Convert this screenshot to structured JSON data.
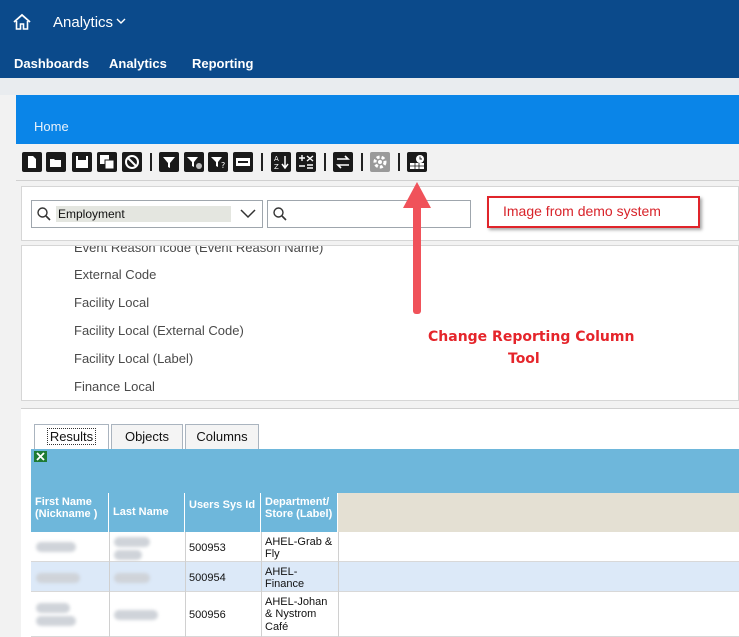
{
  "shell": {
    "app_title": "Analytics",
    "nav": [
      "Dashboards",
      "Analytics",
      "Reporting"
    ]
  },
  "page": {
    "home_label": "Home"
  },
  "search": {
    "combo_value": "Employment",
    "search_value": ""
  },
  "callout": {
    "text": "Image from demo system"
  },
  "fields": [
    "Event Reason Icode (Event Reason Name)",
    "External Code",
    "Facility Local",
    "Facility Local (External Code)",
    "Facility Local (Label)",
    "Finance Local"
  ],
  "annotation": {
    "line1": "Change Reporting Column",
    "line2": "Tool"
  },
  "tabs": [
    "Results",
    "Objects",
    "Columns"
  ],
  "table": {
    "headers": [
      "First Name (Nickname )",
      "Last Name",
      "Users Sys Id",
      "Department/Store (Label)"
    ],
    "rows": [
      {
        "users_sys_id": "500953",
        "department_line1": "AHEL-Grab &",
        "department_line2": "Fly",
        "department_line3": ""
      },
      {
        "users_sys_id": "500954",
        "department_line1": "AHEL-",
        "department_line2": "Finance",
        "department_line3": ""
      },
      {
        "users_sys_id": "500956",
        "department_line1": "AHEL-Johan",
        "department_line2": "& Nystrom",
        "department_line3": "Café"
      }
    ]
  },
  "colors": {
    "shell": "#0b4a8b",
    "band": "#0a85e8",
    "accent_red": "#e5252b",
    "table_header": "#6eb7db"
  },
  "icons": [
    "home-icon",
    "chevron-down-icon",
    "new-icon",
    "open-icon",
    "save-icon",
    "save-as-icon",
    "cancel-icon",
    "filter-icon",
    "filter-settings-icon",
    "filter-help-icon",
    "prompt-icon",
    "sort-icon",
    "calculation-icon",
    "swap-icon",
    "settings-icon",
    "change-column-tool-icon",
    "search-icon",
    "excel-icon"
  ]
}
